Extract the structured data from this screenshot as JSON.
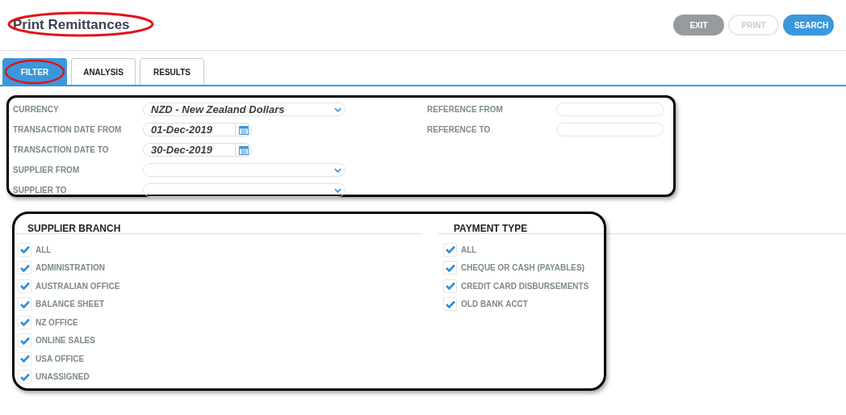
{
  "title": "Print Remittances",
  "buttons": [
    {
      "label": "EXIT",
      "kind": "secondary",
      "disabled": false
    },
    {
      "label": "PRINT",
      "kind": "secondary",
      "disabled": true
    },
    {
      "label": "SEARCH",
      "kind": "primary",
      "disabled": false
    }
  ],
  "tabs": [
    {
      "label": "FILTER",
      "selected": true
    },
    {
      "label": "ANALYSIS",
      "selected": false
    },
    {
      "label": "RESULTS",
      "selected": false
    }
  ],
  "filters_left": [
    {
      "label": "CURRENCY",
      "kind": "select",
      "value": "NZD - New Zealand Dollars"
    },
    {
      "label": "TRANSACTION DATE FROM",
      "kind": "date",
      "value": "01-Dec-2019"
    },
    {
      "label": "TRANSACTION DATE TO",
      "kind": "date",
      "value": "30-Dec-2019"
    },
    {
      "label": "SUPPLIER FROM",
      "kind": "select"
    },
    {
      "label": "SUPPLIER TO",
      "kind": "select"
    }
  ],
  "filters_right": [
    {
      "label": "REFERENCE FROM",
      "kind": "text"
    },
    {
      "label": "REFERENCE TO",
      "kind": "text"
    }
  ],
  "supplier_branch": {
    "heading": "SUPPLIER BRANCH",
    "items": [
      {
        "label": "ALL",
        "checked": true
      },
      {
        "label": "ADMINISTRATION",
        "checked": true
      },
      {
        "label": "AUSTRALIAN OFFICE",
        "checked": true
      },
      {
        "label": "BALANCE SHEET",
        "checked": true
      },
      {
        "label": "NZ OFFICE",
        "checked": true
      },
      {
        "label": "ONLINE SALES",
        "checked": true
      },
      {
        "label": "USA OFFICE",
        "checked": true
      },
      {
        "label": "UNASSIGNED",
        "checked": true
      }
    ]
  },
  "payment_type": {
    "heading": "PAYMENT TYPE",
    "items": [
      {
        "label": "ALL",
        "checked": true
      },
      {
        "label": "CHEQUE OR CASH (PAYABLES)",
        "checked": true
      },
      {
        "label": "CREDIT CARD DISBURSEMENTS",
        "checked": true
      },
      {
        "label": "OLD BANK ACCT",
        "checked": true
      }
    ]
  }
}
